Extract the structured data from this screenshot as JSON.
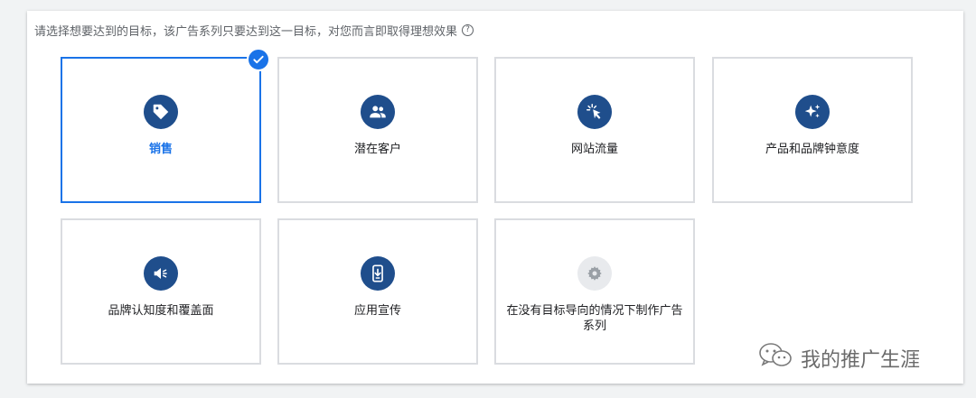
{
  "header": {
    "instruction": "请选择想要达到的目标，该广告系列只要达到这一目标，对您而言即取得理想效果",
    "help_icon": "help-circle-icon"
  },
  "goals": [
    {
      "label": "销售",
      "icon": "tag-icon",
      "selected": true
    },
    {
      "label": "潜在客户",
      "icon": "people-icon",
      "selected": false
    },
    {
      "label": "网站流量",
      "icon": "cursor-click-icon",
      "selected": false
    },
    {
      "label": "产品和品牌钟意度",
      "icon": "sparkle-icon",
      "selected": false
    },
    {
      "label": "品牌认知度和覆盖面",
      "icon": "megaphone-icon",
      "selected": false
    },
    {
      "label": "应用宣传",
      "icon": "phone-download-icon",
      "selected": false
    },
    {
      "label": "在没有目标导向的情况下制作广告系列",
      "icon": "gear-icon",
      "selected": false
    }
  ],
  "watermark": {
    "text": "我的推广生涯",
    "icon": "wechat-icon"
  },
  "colors": {
    "accent": "#1a73e8",
    "icon_bg": "#1f4e8c",
    "border": "#dadce0"
  }
}
